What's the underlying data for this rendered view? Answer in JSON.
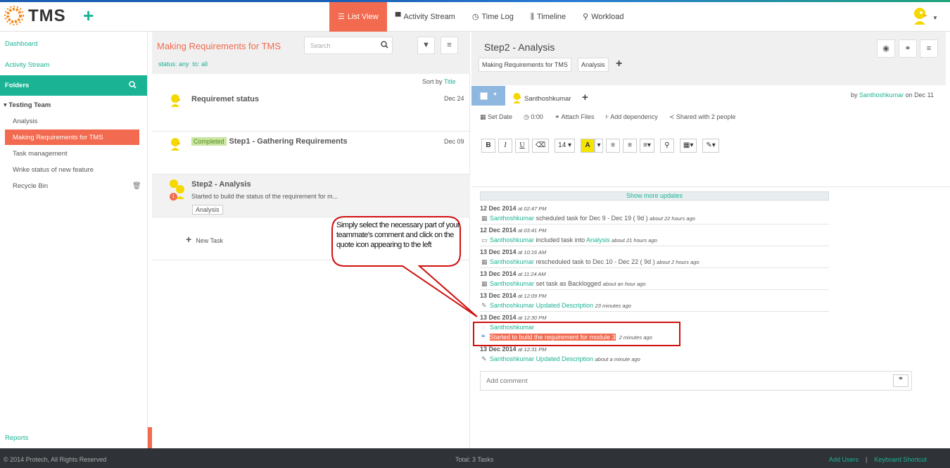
{
  "header": {
    "brand": "TMS",
    "nav": [
      {
        "label": "List View",
        "icon": "list-icon",
        "active": true
      },
      {
        "label": "Activity Stream",
        "icon": "comment-icon"
      },
      {
        "label": "Time Log",
        "icon": "clock-icon"
      },
      {
        "label": "Timeline",
        "icon": "timeline-icon"
      },
      {
        "label": "Workload",
        "icon": "user-icon"
      }
    ]
  },
  "sidebar": {
    "dashboard": "Dashboard",
    "activity": "Activity Stream",
    "folders": "Folders",
    "team": "Testing Team",
    "items": [
      "Analysis",
      "Making Requirements for TMS",
      "Task management",
      "Wrike status of new feature",
      "Recycle Bin"
    ],
    "reports": "Reports"
  },
  "middle": {
    "title": "Making Requirements for TMS",
    "search_placeholder": "Search",
    "status_filter": "status: any",
    "to_filter": "to: all",
    "sort_label": "Sort by",
    "sort_value": "Title",
    "tasks": [
      {
        "name": "Requiremet status",
        "date": "Dec 24"
      },
      {
        "name": "Step1 - Gathering Requirements",
        "date": "Dec 09",
        "badge": "Completed"
      },
      {
        "name": "Step2 - Analysis",
        "desc": "Started to build the status of the requirement for m...",
        "tag": "Analysis",
        "count": "1"
      }
    ],
    "new_task": "New Task"
  },
  "detail": {
    "title": "Step2 - Analysis",
    "tags": [
      "Making Requirements for TMS",
      "Analysis"
    ],
    "assignee": "Santhoshkumar",
    "by_prefix": "by",
    "by_user": "Santhoshkumar",
    "by_date": "on Dec 11",
    "actions": [
      "Set Date",
      "0:00",
      "Attach Files",
      "Add dependency",
      "Shared with 2 people"
    ],
    "toolbar": [
      "B",
      "I",
      "U",
      "⌫",
      "14 ▾",
      "A",
      "▾",
      "≡",
      "≡",
      "≡▾",
      "⚲",
      "▦▾",
      "✎▾"
    ],
    "show_more": "Show more updates",
    "updates": [
      {
        "date": "12 Dec 2014",
        "time": "at 02:47 PM",
        "user": "Santhoshkumar",
        "text": "scheduled task for Dec 9 - Dec 19 ( 9d )",
        "ago": "about 22 hours ago"
      },
      {
        "date": "12 Dec 2014",
        "time": "at 03:41 PM",
        "user": "Santhoshkumar",
        "text": "included task into",
        "link": "Analysis",
        "ago": "about 21 hours ago"
      },
      {
        "date": "13 Dec 2014",
        "time": "at 10:16 AM",
        "user": "Santhoshkumar",
        "text": "rescheduled task to Dec 10 - Dec 22 ( 9d )",
        "ago": "about 2 hours ago"
      },
      {
        "date": "13 Dec 2014",
        "time": "at 11:24 AM",
        "user": "Santhoshkumar",
        "text": "set task as Backlogged",
        "ago": "about an hour ago"
      },
      {
        "date": "13 Dec 2014",
        "time": "at 12:09 PM",
        "user": "Santhoshkumar",
        "link": "Updated Description",
        "ago": "23 minutes ago"
      },
      {
        "date": "13 Dec 2014",
        "time": "at 12:30 PM",
        "user": "Santhoshkumar",
        "quote": "Started to build the requirement for module 3",
        "ago": "2 minutes ago"
      },
      {
        "date": "13 Dec 2014",
        "time": "at 12:31 PM",
        "user": "Santhoshkumar",
        "link": "Updated Description",
        "ago": "about a minute ago"
      }
    ],
    "comment_placeholder": "Add comment"
  },
  "callout": "Simply select the necessary part of your teammate's comment and click on the quote icon appearing to the left",
  "footer": {
    "copyright": "© 2014 Protech, All Rights Reserved",
    "total": "Total: 3 Tasks",
    "add_users": "Add Users",
    "divider": "|",
    "shortcut": "Keyboard Shortcut"
  }
}
